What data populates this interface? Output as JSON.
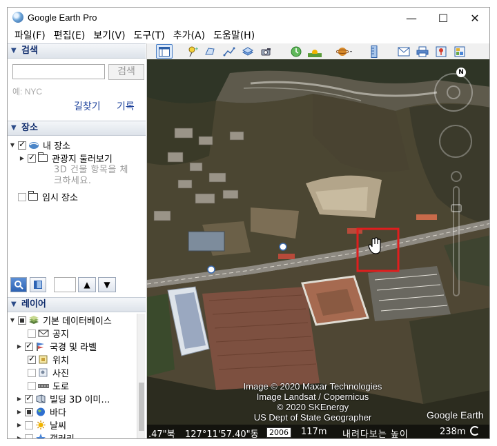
{
  "window": {
    "title": "Google Earth Pro",
    "minimize": "—",
    "maximize": "☐",
    "close": "✕"
  },
  "menu": [
    "파일(F)",
    "편집(E)",
    "보기(V)",
    "도구(T)",
    "추가(A)",
    "도움말(H)"
  ],
  "search": {
    "header": "검색",
    "placeholder": "",
    "button": "검색",
    "hint": "예: NYC",
    "directions": "길찾기",
    "history": "기록"
  },
  "places": {
    "header": "장소",
    "my_places": "내 장소",
    "tour": "관광지 둘러보기",
    "tour_hint": "3D 건물 항목을 체크하세요.",
    "temp": "임시 장소"
  },
  "layers": {
    "header": "레이어",
    "primary_db": "기본 데이터베이스",
    "items": [
      "공지",
      "국경 및 라벨",
      "위치",
      "사진",
      "도로",
      "빌딩 3D 이미…",
      "바다",
      "날씨",
      "갤러리"
    ]
  },
  "map": {
    "credits": [
      "Image © 2020 Maxar Technologies",
      "Image Landsat / Copernicus",
      "© 2020 SKEnergy",
      "US Dept of State Geographer"
    ],
    "logo": "Google Earth",
    "compass_n": "N"
  },
  "status": {
    "lat": ".47\"북",
    "lon": "127°11'57.40\"동",
    "year": "2006",
    "elevation": "117m",
    "view_label": "내려다보는 높이",
    "eye_alt": "238m"
  },
  "colors": {
    "highlight_box": "#e01e1e",
    "panel_header_text": "#0d2a6b",
    "link": "#1a3f9a"
  }
}
